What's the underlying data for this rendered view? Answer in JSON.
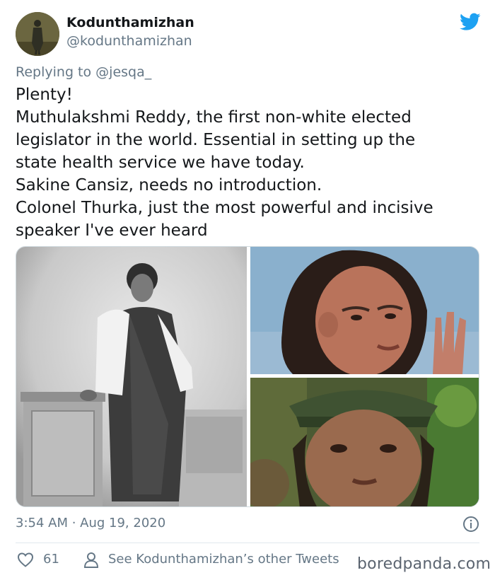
{
  "header": {
    "display_name": "Kodunthamizhan",
    "handle": "@kodunthamizhan"
  },
  "reply": {
    "prefix": "Replying to",
    "mention": "@jesqa_"
  },
  "body_lines": [
    "Plenty!",
    "Muthulakshmi Reddy, the first non-white elected",
    "legislator in the world. Essential in setting up the",
    "state health service we have today.",
    "Sakine Cansiz, needs no introduction.",
    "Colonel Thurka, just the most powerful and incisive",
    "speaker I've ever heard"
  ],
  "meta": {
    "timestamp": "3:54 AM · Aug 19, 2020"
  },
  "actions": {
    "like_count": "61",
    "other_tweets_label": "See Kodunthamizhan’s other Tweets"
  },
  "watermark": "boredpanda.com",
  "colors": {
    "twitter_blue": "#1da1f2",
    "secondary_text": "#657786",
    "primary_text": "#14171a"
  },
  "icons": {
    "brand": "twitter-bird-icon",
    "info": "info-icon",
    "like": "heart-icon",
    "profile": "person-icon"
  }
}
